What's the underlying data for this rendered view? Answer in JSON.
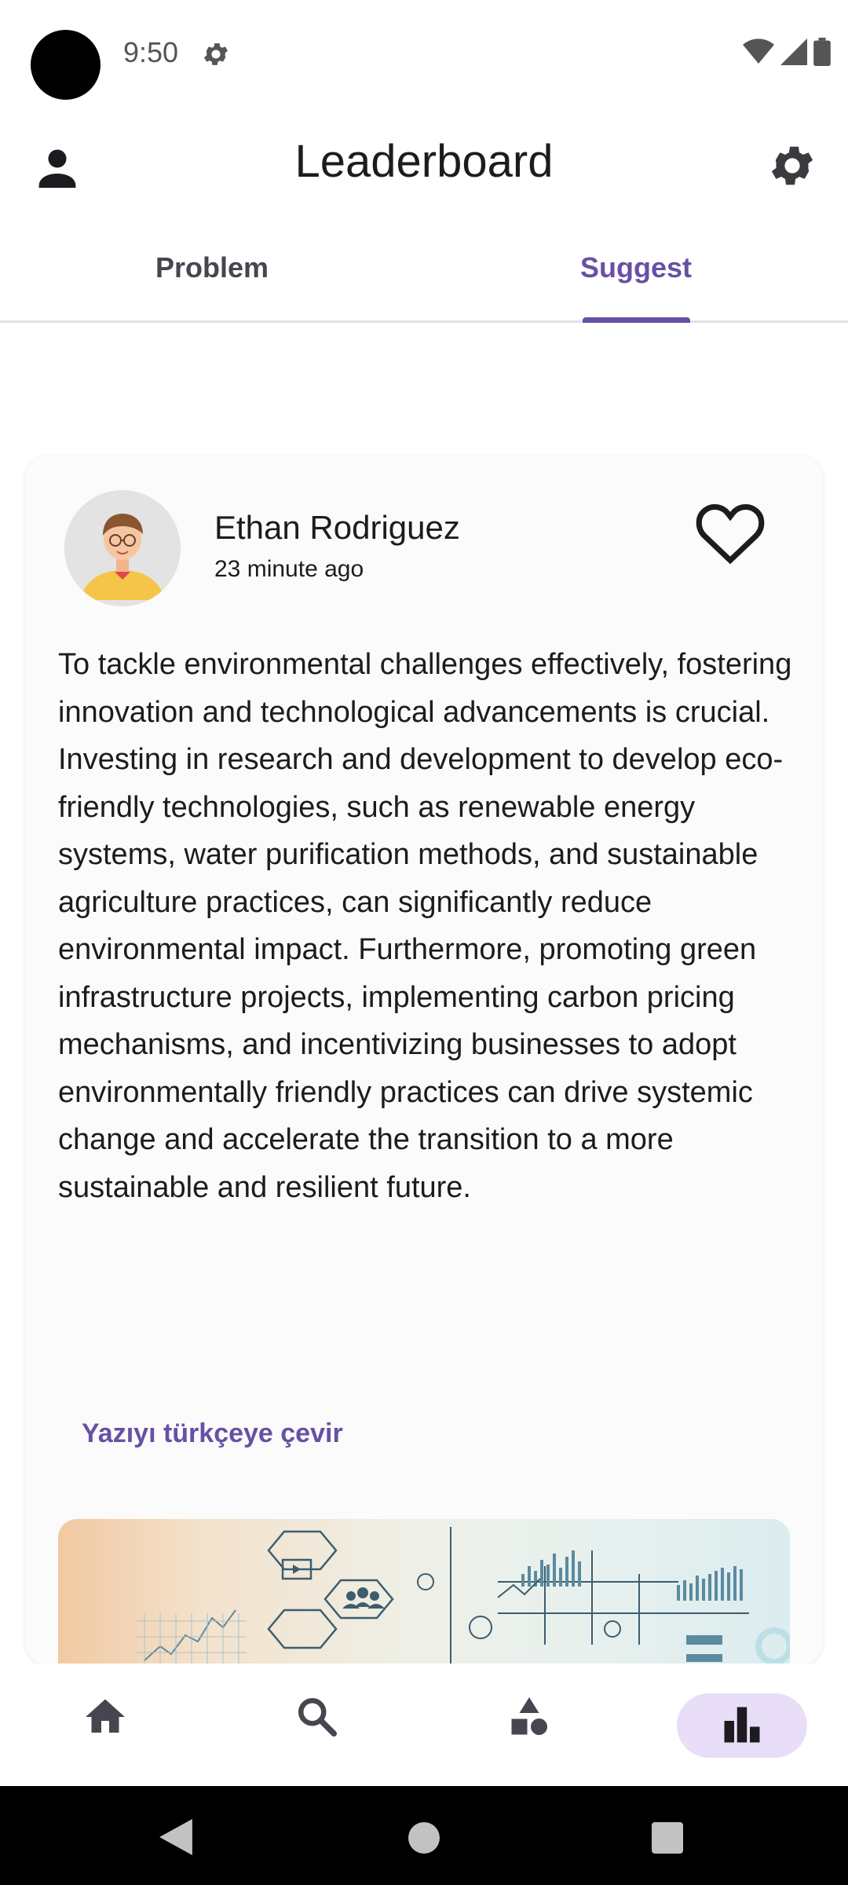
{
  "status": {
    "time": "9:50"
  },
  "appbar": {
    "title": "Leaderboard"
  },
  "tabs": [
    {
      "label": "Problem"
    },
    {
      "label": "Suggest"
    }
  ],
  "post": {
    "author": "Ethan Rodriguez",
    "time_ago": "23 minute ago",
    "body": "To tackle environmental challenges effectively, fostering innovation and technological advancements is crucial. Investing in research and development to develop eco-friendly technologies, such as renewable energy systems, water purification methods, and sustainable agriculture practices, can significantly reduce environmental impact. Furthermore, promoting green infrastructure projects, implementing carbon pricing mechanisms, and incentivizing businesses to adopt environmentally friendly practices can drive systemic change and accelerate the transition to a more sustainable and resilient future.",
    "translate_label": "Yazıyı türkçeye çevir"
  },
  "icons": {
    "profile": "person-icon",
    "settings": "gear-icon",
    "favorite": "heart-outline-icon",
    "nav": [
      "home-icon",
      "search-icon",
      "shapes-icon",
      "leaderboard-icon"
    ]
  },
  "colors": {
    "accent": "#6750a4",
    "active_pill": "#e8def8"
  }
}
